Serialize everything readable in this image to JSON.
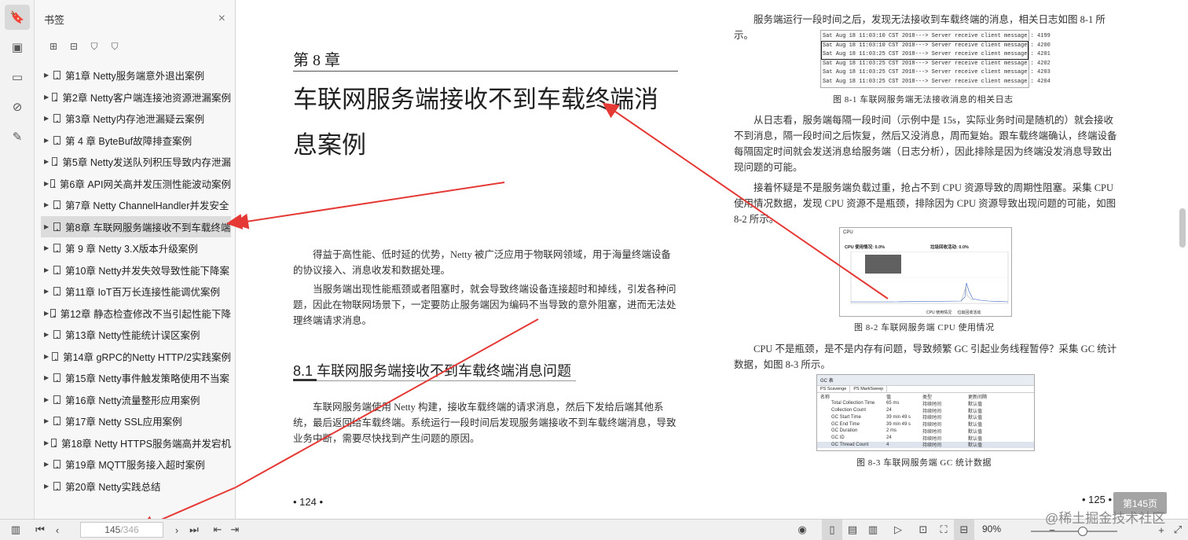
{
  "panel": {
    "title": "书签",
    "close": "×",
    "bookmarks": [
      "第1章 Netty服务端意外退出案例",
      "第2章 Netty客户端连接池资源泄漏案例",
      "第3章 Netty内存池泄漏疑云案例",
      "第 4 章 ByteBuf故障排查案例",
      "第5章 Netty发送队列积压导致内存泄漏",
      "第6章 API网关高并发压测性能波动案例",
      "第7章 Netty ChannelHandler并发安全",
      "第8章 车联网服务端接收不到车载终端",
      "第 9 章 Netty 3.X版本升级案例",
      "第10章 Netty并发失效导致性能下降案",
      "第11章 IoT百万长连接性能调优案例",
      "第12章 静态检查修改不当引起性能下降",
      "第13章 Netty性能统计误区案例",
      "第14章 gRPC的Netty HTTP/2实践案例",
      "第15章 Netty事件触发策略使用不当案",
      "第16章 Netty流量整形应用案例",
      "第17章 Netty SSL应用案例",
      "第18章 Netty HTTPS服务端高并发宕机",
      "第19章 MQTT服务接入超时案例",
      "第20章 Netty实践总结"
    ],
    "selected_index": 7
  },
  "left_page": {
    "chapter_number": "第 8 章",
    "chapter_title": "车联网服务端接收不到车载终端消息案例",
    "para1": "得益于高性能、低时延的优势，Netty 被广泛应用于物联网领域，用于海量终端设备的协议接入、消息收发和数据处理。",
    "para2": "当服务端出现性能瓶颈或者阻塞时，就会导致终端设备连接超时和掉线，引发各种问题，因此在物联网场景下，一定要防止服务端因为编码不当导致的意外阻塞，进而无法处理终端请求消息。",
    "section_title": "8.1   车联网服务端接收不到车载终端消息问题",
    "para3": "车联网服务端使用 Netty 构建，接收车载终端的请求消息，然后下发给后端其他系统，最后返回给车载终端。系统运行一段时间后发现服务端接收不到车载终端消息，导致业务中断，需要尽快找到产生问题的原因。",
    "page_number": "• 124 •"
  },
  "right_page": {
    "intro": "服务端运行一段时间之后，发现无法接收到车载终端的消息，相关日志如图 8-1 所示。",
    "log_lines": [
      "Sat Aug 18 11:03:10 CST 2018---> Server receive client message : 4199",
      "Sat Aug 18 11:03:10 CST 2018---> Server receive client message : 4200",
      "Sat Aug 18 11:03:25 CST 2018---> Server receive client message : 4201",
      "Sat Aug 18 11:03:25 CST 2018---> Server receive client message : 4202",
      "Sat Aug 18 11:03:25 CST 2018---> Server receive client message : 4203",
      "Sat Aug 18 11:03:25 CST 2018---> Server receive client message : 4204"
    ],
    "fig1_caption": "图 8-1   车联网服务端无法接收消息的相关日志",
    "para_a": "从日志看，服务端每隔一段时间（示例中是 15s，实际业务时间是随机的）就会接收不到消息，隔一段时间之后恢复，然后又没消息，周而复始。跟车载终端确认，终端设备每隔固定时间就会发送消息给服务端（日志分析），因此排除是因为终端没发消息导致出现问题的可能。",
    "para_b": "接着怀疑是不是服务端负载过重，抢占不到 CPU 资源导致的周期性阻塞。采集 CPU 使用情况数据，发现 CPU 资源不是瓶颈，排除因为 CPU 资源导致出现问题的可能，如图 8-2 所示。",
    "cpu_title": "CPU",
    "cpu_usage": "CPU 使用情况: 0.0%",
    "cpu_gc": "垃圾回收活动: 0.0%",
    "cpu_legend1": "CPU 使用情况",
    "cpu_legend2": "垃圾回收活动",
    "fig2_caption": "图 8-2   车联网服务端 CPU 使用情况",
    "para_c": "CPU 不是瓶颈，是不是内存有问题，导致频繁 GC 引起业务线程暂停？采集 GC 统计数据，如图 8-3 所示。",
    "gc_title": "GC 表",
    "gc_tabs": [
      "PS Scavenge",
      "PS MarkSweep"
    ],
    "gc_headers": [
      "名称",
      "值",
      "类型",
      "更新间隔"
    ],
    "gc_rows": [
      [
        "Total Collection Time",
        "65 ms",
        "持续时间",
        "默认值"
      ],
      [
        "Collection Count",
        "24",
        "持续时间",
        "默认值"
      ],
      [
        "GC Start Time",
        "39 min 49 s",
        "持续时间",
        "默认值"
      ],
      [
        "GC End Time",
        "39 min 49 s",
        "持续时间",
        "默认值"
      ],
      [
        "GC Duration",
        "2 ms",
        "持续时间",
        "默认值"
      ],
      [
        "GC ID",
        "24",
        "持续时间",
        "默认值"
      ],
      [
        "GC Thread Count",
        "4",
        "持续时间",
        "默认值"
      ]
    ],
    "fig3_caption": "图 8-3   车联网服务端 GC 统计数据",
    "page_number": "• 125 •"
  },
  "toolbar": {
    "page_current": "145",
    "page_total": "/346",
    "zoom": "90%",
    "tooltip": "第145页"
  },
  "watermark": "@稀土掘金技术社区",
  "colors": {
    "annotation_arrow": "#e53935",
    "accent": "#2f7be0"
  }
}
